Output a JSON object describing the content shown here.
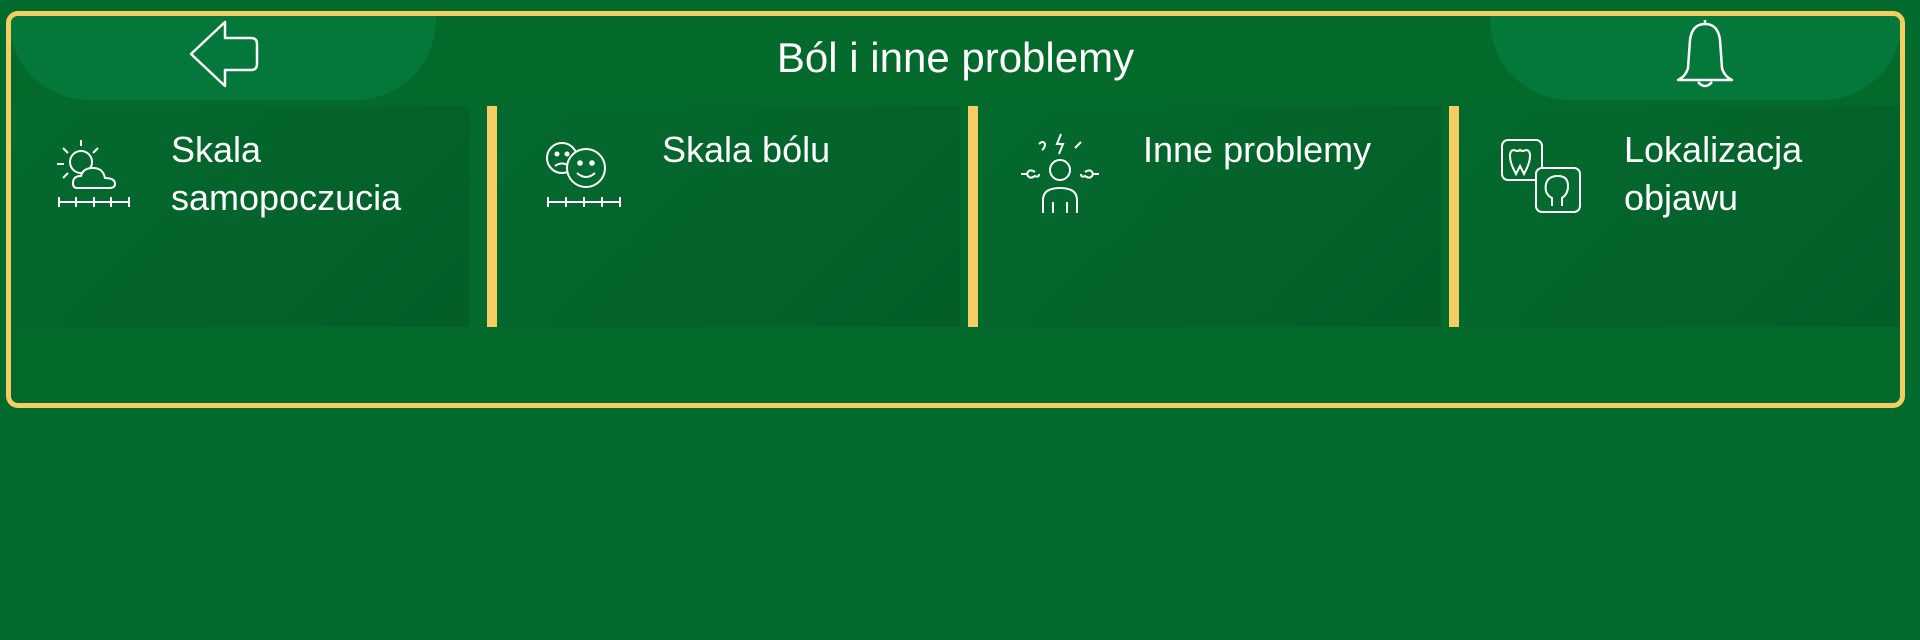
{
  "header": {
    "title": "Ból i inne problemy",
    "back_icon": "back-arrow-icon",
    "bell_icon": "bell-icon"
  },
  "tiles": [
    {
      "label": "Skala\nsamopoczucia",
      "icon": "weather-scale-icon"
    },
    {
      "label": "Skala bólu",
      "icon": "face-scale-icon"
    },
    {
      "label": "Inne problemy",
      "icon": "person-symptoms-icon"
    },
    {
      "label": "Lokalizacja\nobjawu",
      "icon": "body-location-icon"
    }
  ],
  "colors": {
    "background": "#016a2c",
    "accent": "#f6cd63",
    "tile": "#046a2f",
    "header_button": "#04773a"
  }
}
